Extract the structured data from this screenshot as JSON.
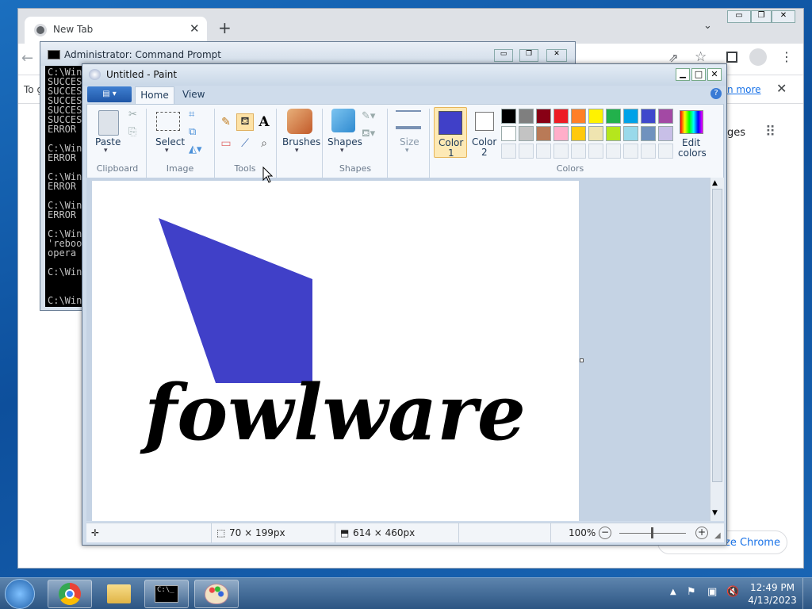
{
  "browser": {
    "tab_title": "New Tab",
    "infobar_prefix": "To g",
    "infobar_link": "n more",
    "right_text": "ges",
    "bottom_button": "ze Chrome"
  },
  "cmd": {
    "title": "Administrator: Command Prompt",
    "lines": [
      "C:\\Win",
      "SUCCES",
      "SUCCES",
      "SUCCES",
      "SUCCES",
      "SUCCES",
      "ERROR",
      "",
      "C:\\Win",
      "ERROR",
      "",
      "C:\\Win",
      "ERROR",
      "",
      "C:\\Win",
      "ERROR",
      "",
      "C:\\Win",
      "'reboo",
      "opera",
      "",
      "C:\\Win",
      "",
      "",
      "C:\\Win"
    ]
  },
  "paint": {
    "title": "Untitled - Paint",
    "tabs": {
      "home": "Home",
      "view": "View"
    },
    "groups": {
      "clipboard": "Clipboard",
      "image": "Image",
      "tools": "Tools",
      "shapes": "Shapes",
      "colors": "Colors"
    },
    "buttons": {
      "paste": "Paste",
      "select": "Select",
      "brushes": "Brushes",
      "shapes": "Shapes",
      "size": "Size",
      "color1_a": "Color",
      "color1_b": "1",
      "color2_a": "Color",
      "color2_b": "2",
      "edit_a": "Edit",
      "edit_b": "colors"
    },
    "color1": "#4040c8",
    "color2": "#ffffff",
    "palette_row1": [
      "#000000",
      "#7f7f7f",
      "#880015",
      "#ed1c24",
      "#ff7f27",
      "#fff200",
      "#22b14c",
      "#00a2e8",
      "#3f48cc",
      "#a349a4"
    ],
    "palette_row2": [
      "#ffffff",
      "#c3c3c3",
      "#b97a57",
      "#ffaec9",
      "#ffc90e",
      "#efe4b0",
      "#b5e61d",
      "#99d9ea",
      "#7092be",
      "#c8bfe7"
    ],
    "canvas_text": "fowlware",
    "shape_color": "#4040c8",
    "status": {
      "selection": "70 × 199px",
      "canvas_size": "614 × 460px",
      "zoom": "100%"
    }
  },
  "taskbar": {
    "time": "12:49 PM",
    "date": "4/13/2023"
  }
}
